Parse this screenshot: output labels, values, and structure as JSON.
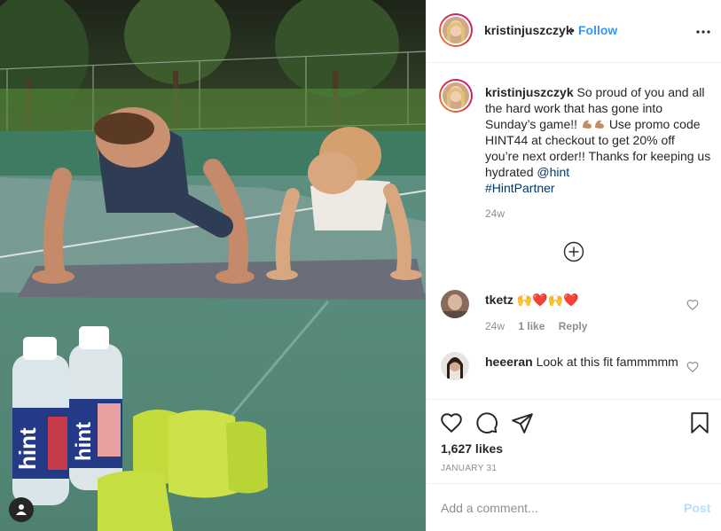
{
  "post": {
    "author": "kristinjuszczyk",
    "follow_label": "Follow",
    "dot": "•",
    "caption": {
      "part1": "So proud of you and all the hard work that has gone into Sunday’s game!!",
      "part2": "Use promo code HINT44 at checkout to get 20% off you’re next order!! Thanks for keeping us hydrated",
      "mention": "@hint",
      "hashtag": "#HintPartner"
    },
    "caption_time": "24w",
    "likes": "1,627 likes",
    "date": "JANUARY 31"
  },
  "comments": [
    {
      "user": "tketz",
      "text": "🙌❤️🙌❤️",
      "time": "24w",
      "likes": "1 like",
      "reply": "Reply"
    },
    {
      "user": "heeeran",
      "text": "Look at this fit fammmmm"
    }
  ],
  "add_comment": {
    "placeholder": "Add a comment...",
    "post_label": "Post"
  },
  "bottle_brand": "hint",
  "colors": {
    "accent": "#3897f0",
    "post_disabled": "#b2dffc",
    "text": "#262626",
    "muted": "#8e8e8e"
  },
  "icons": [
    "more-options-icon",
    "load-more-comments-icon",
    "heart-icon",
    "comment-icon",
    "share-icon",
    "bookmark-icon",
    "user-tags-icon",
    "comment-like-icon"
  ]
}
